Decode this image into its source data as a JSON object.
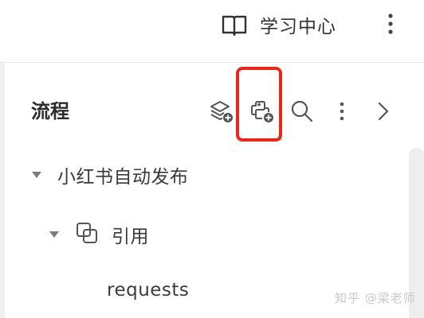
{
  "header": {
    "learn_center_label": "学习中心"
  },
  "panel": {
    "title": "流程"
  },
  "tree": {
    "flow_name": "小红书自动发布",
    "reference_label": "引用",
    "requests_label": "requests"
  },
  "watermark": {
    "text": "知乎 @梁老师"
  },
  "colors": {
    "highlight": "#e8261c",
    "icon": "#555555"
  }
}
